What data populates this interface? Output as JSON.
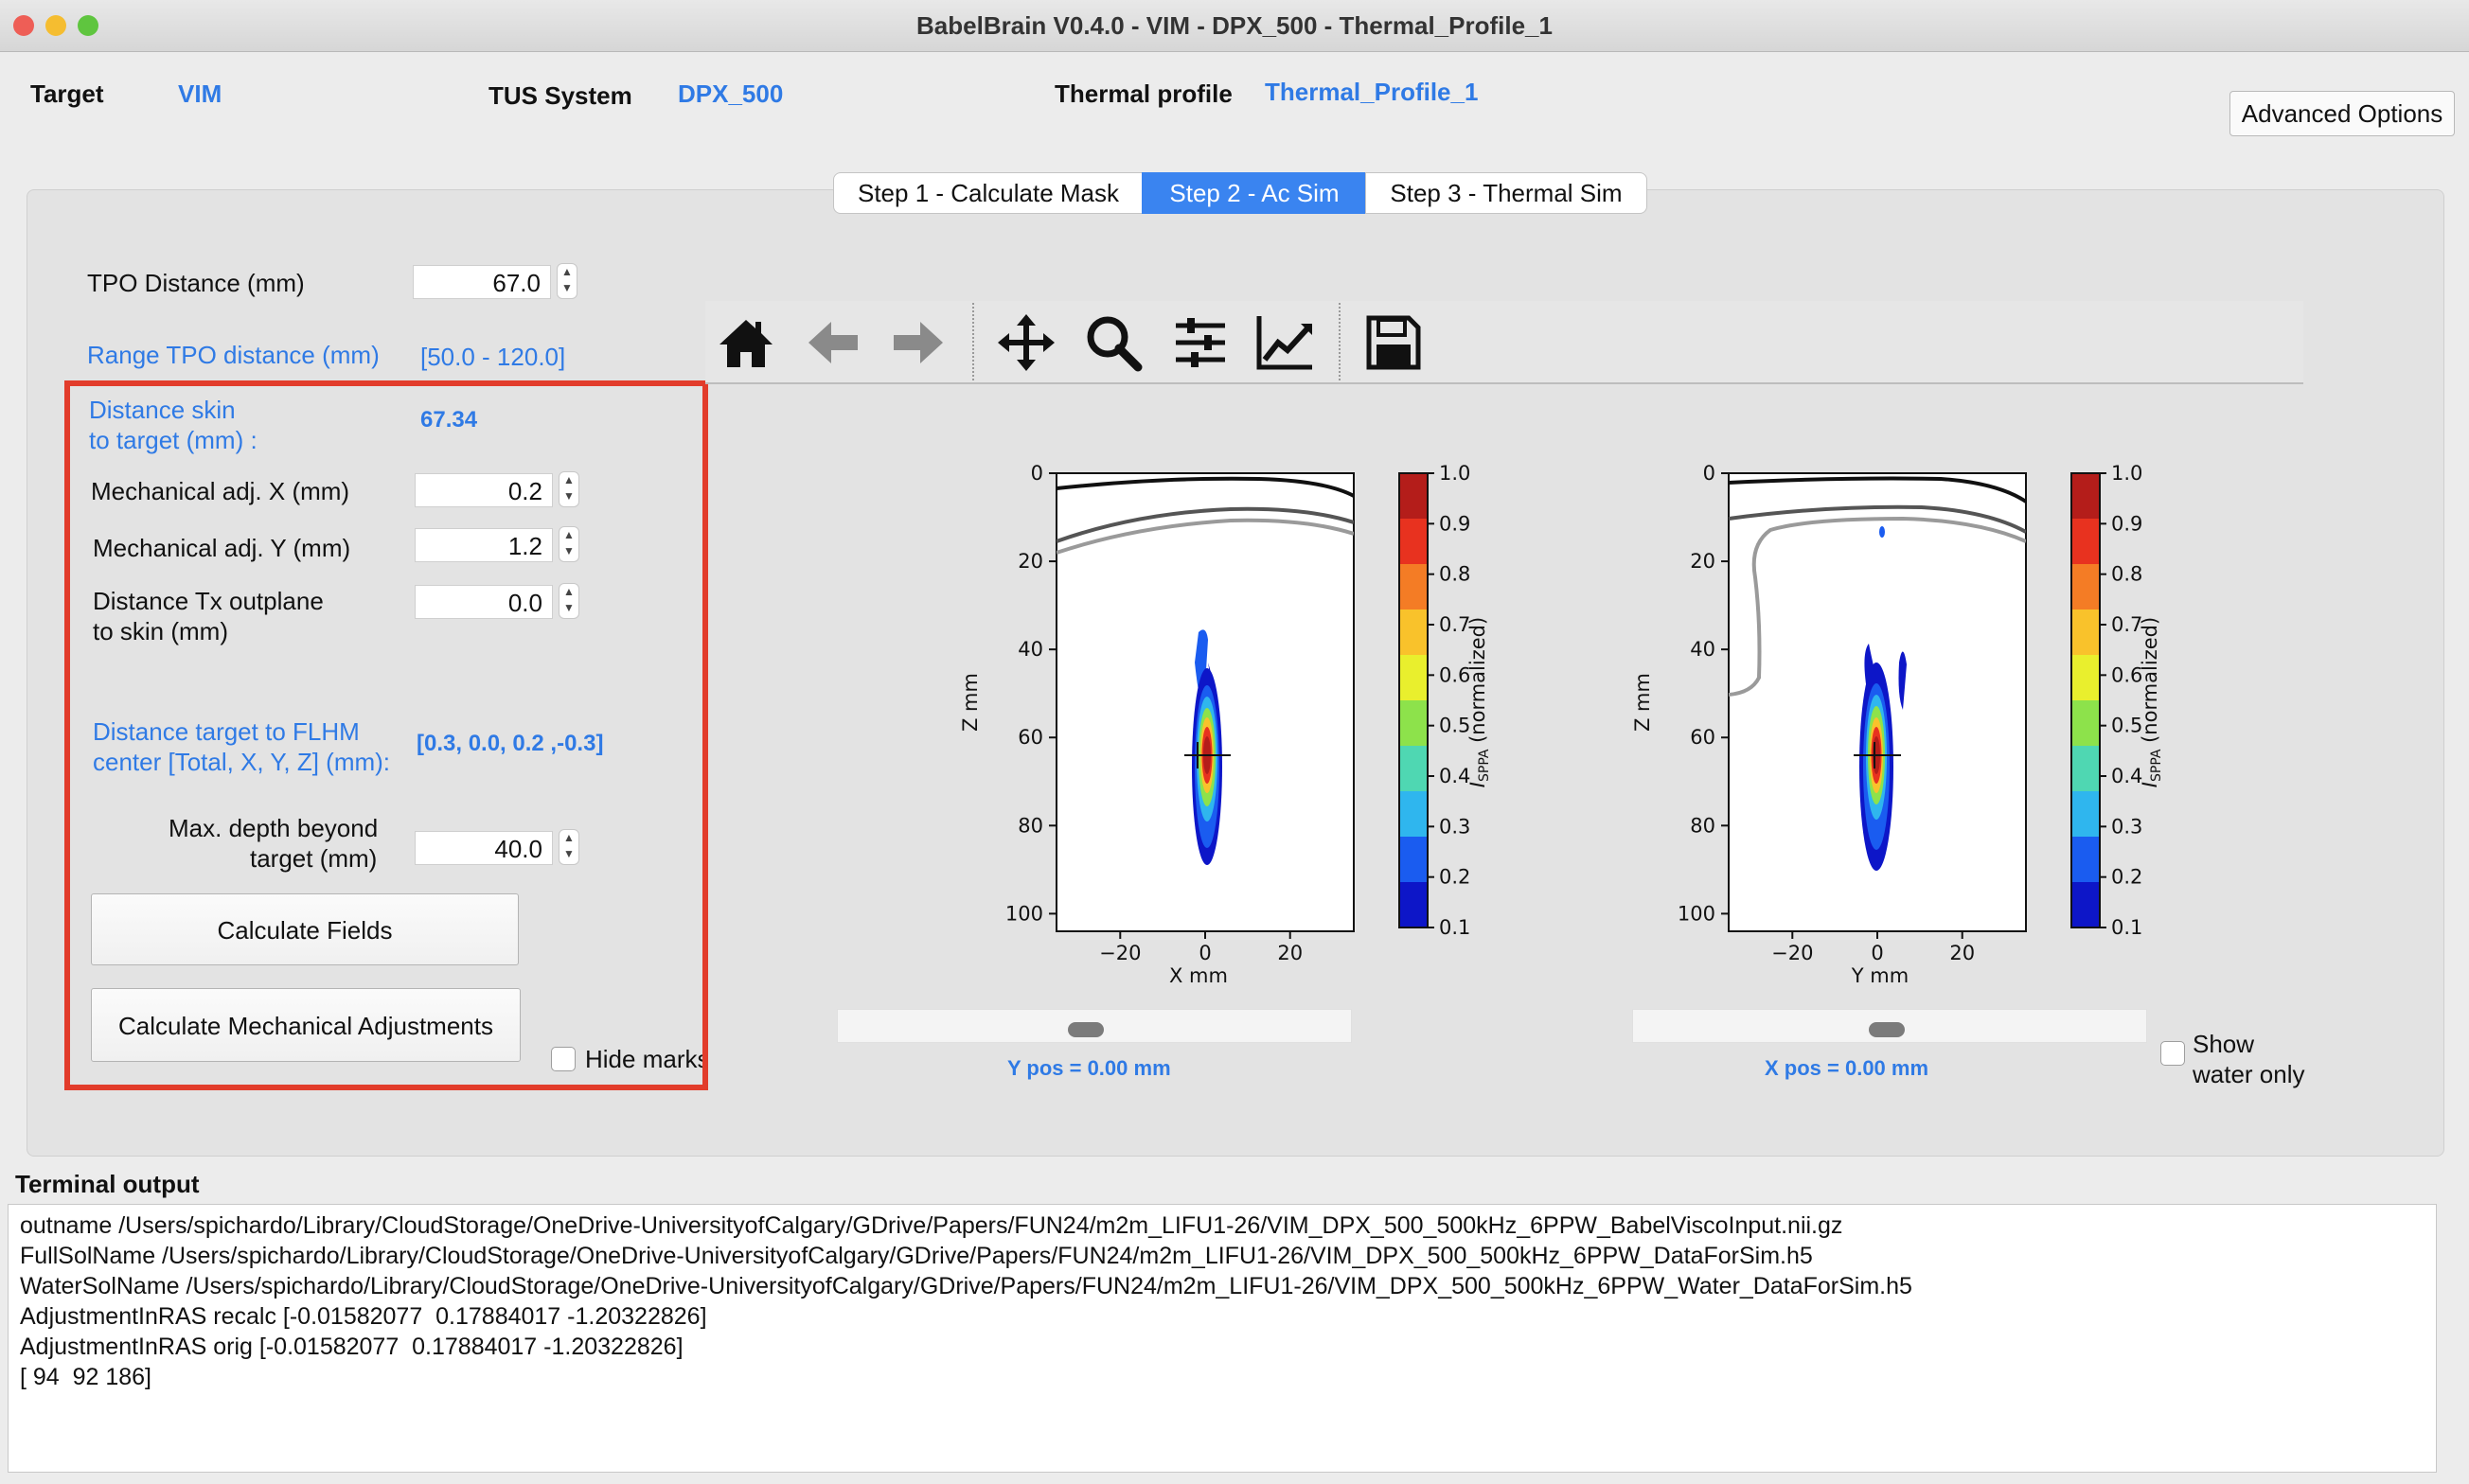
{
  "window": {
    "title": "BabelBrain V0.4.0 - VIM - DPX_500 - Thermal_Profile_1"
  },
  "header": {
    "target_label": "Target",
    "target_value": "VIM",
    "tus_label": "TUS System",
    "tus_value": "DPX_500",
    "thermal_label": "Thermal profile",
    "thermal_value": "Thermal_Profile_1",
    "advanced_button": "Advanced Options"
  },
  "tabs": [
    {
      "label": "Step 1 - Calculate Mask",
      "active": false
    },
    {
      "label": "Step 2 - Ac Sim",
      "active": true
    },
    {
      "label": "Step 3 - Thermal Sim",
      "active": false
    }
  ],
  "form": {
    "tpo_label": "TPO Distance (mm)",
    "tpo_value": "67.0",
    "range_label": "Range TPO distance (mm)",
    "range_value": "[50.0 - 120.0]",
    "skin_label_1": "Distance skin",
    "skin_label_2": "to target (mm) :",
    "skin_value": "67.34",
    "mechx_label": "Mechanical adj. X (mm)",
    "mechx_value": "0.2",
    "mechy_label": "Mechanical adj. Y (mm)",
    "mechy_value": "1.2",
    "outplane_label_1": "Distance Tx outplane",
    "outplane_label_2": "to skin (mm)",
    "outplane_value": "0.0",
    "flhm_label_1": "Distance target to FLHM",
    "flhm_label_2": "center [Total, X, Y, Z] (mm):",
    "flhm_value": "[0.3, 0.0, 0.2 ,-0.3]",
    "depth_label_1": "Max. depth beyond",
    "depth_label_2": "target (mm)",
    "depth_value": "40.0",
    "calc_fields_button": "Calculate Fields",
    "calc_mech_button": "Calculate Mechanical Adjustments",
    "hide_marks_label": "Hide marks"
  },
  "toolbar": {
    "icons": [
      "home-icon",
      "back-arrow-icon",
      "forward-arrow-icon",
      "pan-icon",
      "zoom-icon",
      "configure-subplots-icon",
      "edit-axis-icon",
      "save-icon"
    ]
  },
  "plots": {
    "left": {
      "xlabel": "X mm",
      "ylabel": "Z mm",
      "slider_text": "Y pos = 0.00 mm"
    },
    "right": {
      "xlabel": "Y mm",
      "ylabel": "Z mm",
      "slider_text": "X pos = 0.00 mm"
    },
    "colorbar_label": "I",
    "colorbar_sub": "SPPA",
    "colorbar_suffix": " (normalized)",
    "x_ticks": [
      "−20",
      "0",
      "20"
    ],
    "y_ticks": [
      "0",
      "20",
      "40",
      "60",
      "80",
      "100"
    ],
    "colorbar_ticks": [
      "1.0",
      "0.9",
      "0.8",
      "0.7",
      "0.6",
      "0.5",
      "0.4",
      "0.3",
      "0.2",
      "0.1"
    ],
    "colorbar_colors": [
      "#b41d1a",
      "#e8321f",
      "#f47c25",
      "#f9c22b",
      "#e9ef2d",
      "#8de24b",
      "#4fd7b2",
      "#2fb6ee",
      "#1a5cf0",
      "#0d16c8"
    ],
    "show_water_label_1": "Show",
    "show_water_label_2": "water only"
  },
  "terminal": {
    "label": "Terminal output",
    "lines": [
      "outname /Users/spichardo/Library/CloudStorage/OneDrive-UniversityofCalgary/GDrive/Papers/FUN24/m2m_LIFU1-26/VIM_DPX_500_500kHz_6PPW_BabelViscoInput.nii.gz",
      "FullSolName /Users/spichardo/Library/CloudStorage/OneDrive-UniversityofCalgary/GDrive/Papers/FUN24/m2m_LIFU1-26/VIM_DPX_500_500kHz_6PPW_DataForSim.h5",
      "WaterSolName /Users/spichardo/Library/CloudStorage/OneDrive-UniversityofCalgary/GDrive/Papers/FUN24/m2m_LIFU1-26/VIM_DPX_500_500kHz_6PPW_Water_DataForSim.h5",
      "AdjustmentInRAS recalc [-0.01582077  0.17884017 -1.20322826]",
      "AdjustmentInRAS orig [-0.01582077  0.17884017 -1.20322826]",
      "[ 94  92 186]"
    ]
  }
}
